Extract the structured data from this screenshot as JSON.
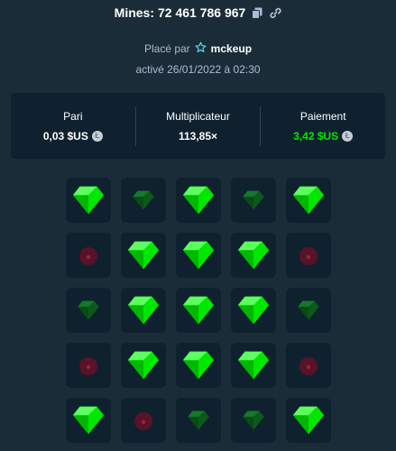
{
  "header": {
    "label": "Mines:",
    "game_id": "72 461 786 967"
  },
  "bet_info": {
    "placed_by_label": "Placé par",
    "username": "mckeup",
    "activated_text": "activé 26/01/2022 à 02:30"
  },
  "stats": [
    {
      "label": "Pari",
      "value": "0,03 $US",
      "coin": "Ł",
      "color": "#ffffff"
    },
    {
      "label": "Multiplicateur",
      "value": "113,85×",
      "coin": "",
      "color": "#ffffff"
    },
    {
      "label": "Paiement",
      "value": "3,42 $US",
      "coin": "Ł",
      "color": "#00e701"
    }
  ],
  "board": {
    "rows": [
      [
        "gem",
        "gem-faded",
        "gem",
        "gem-faded",
        "gem"
      ],
      [
        "mine-faded",
        "gem",
        "gem",
        "gem",
        "mine-faded"
      ],
      [
        "gem-faded",
        "gem",
        "gem",
        "gem",
        "gem-faded"
      ],
      [
        "mine-faded",
        "gem",
        "gem",
        "gem",
        "mine-faded"
      ],
      [
        "gem",
        "mine-faded",
        "gem-faded",
        "gem-faded",
        "gem"
      ]
    ]
  },
  "colors": {
    "gem": "#00e701",
    "gem_faded": "#0c5a1a",
    "mine_faded": "#5a1226",
    "tile_bg": "#0f212e"
  }
}
